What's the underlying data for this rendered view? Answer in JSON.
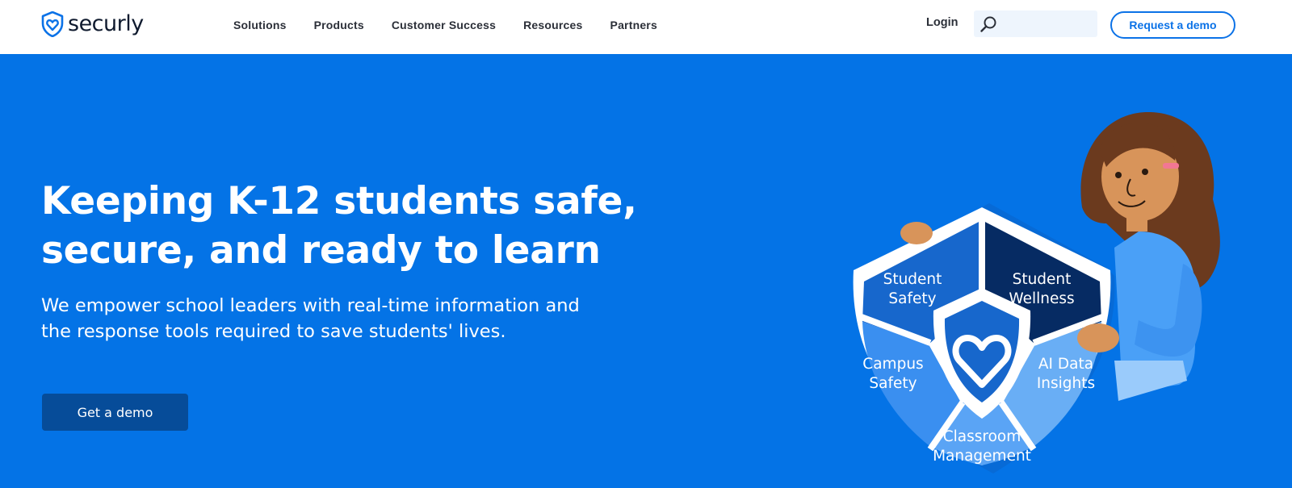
{
  "brand": {
    "name": "securly",
    "accent": "#0b72e7"
  },
  "nav": {
    "items": [
      {
        "label": "Solutions"
      },
      {
        "label": "Products"
      },
      {
        "label": "Customer Success"
      },
      {
        "label": "Resources"
      },
      {
        "label": "Partners"
      }
    ]
  },
  "header": {
    "login_label": "Login",
    "search_placeholder": "",
    "demo_button_label": "Request a demo"
  },
  "hero": {
    "headline_line1": "Keeping K-12 students safe,",
    "headline_line2": "secure, and ready to learn",
    "subtext_line1": "We empower school leaders with real-time information and",
    "subtext_line2": "the response tools required to save students' lives.",
    "cta_label": "Get a demo",
    "background": "#0473e6"
  },
  "shield": {
    "segments": [
      {
        "line1": "Student",
        "line2": "Safety"
      },
      {
        "line1": "Student",
        "line2": "Wellness"
      },
      {
        "line1": "Campus",
        "line2": "Safety"
      },
      {
        "line1": "AI Data",
        "line2": "Insights"
      },
      {
        "line1": "Classroom",
        "line2": "Management"
      }
    ]
  }
}
